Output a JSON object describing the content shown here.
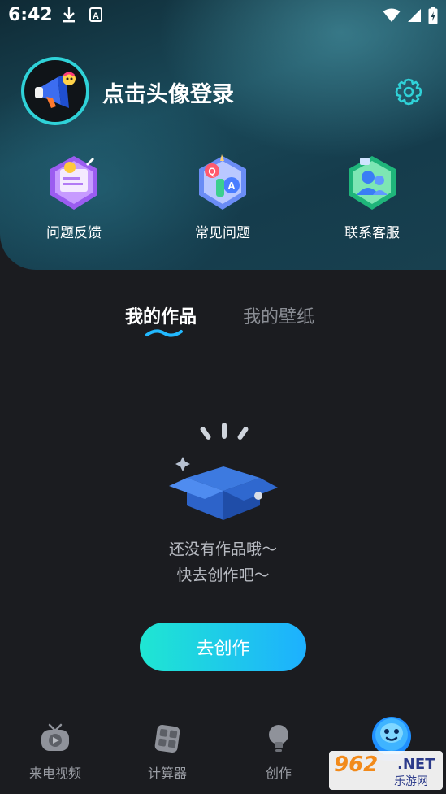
{
  "status_bar": {
    "time": "6:42"
  },
  "profile": {
    "login_text": "点击头像登录"
  },
  "shortcuts": [
    {
      "label": "问题反馈",
      "icon": "feedback-icon"
    },
    {
      "label": "常见问题",
      "icon": "faq-icon"
    },
    {
      "label": "联系客服",
      "icon": "customer-service-icon"
    }
  ],
  "tabs": [
    {
      "label": "我的作品",
      "active": true
    },
    {
      "label": "我的壁纸",
      "active": false
    }
  ],
  "empty_state": {
    "line1": "还没有作品哦～",
    "line2": "快去创作吧～",
    "icon": "empty-box-icon"
  },
  "create_button": {
    "label": "去创作"
  },
  "bottom_nav": [
    {
      "label": "来电视频",
      "icon": "tv-icon"
    },
    {
      "label": "计算器",
      "icon": "calculator-icon"
    },
    {
      "label": "创作",
      "icon": "bulb-icon"
    },
    {
      "label": "",
      "icon": "mascot-icon"
    }
  ],
  "watermark": {
    "number": "962",
    "suffix": ".NET",
    "text": "乐游网"
  },
  "colors": {
    "accent": "#2fd2d8",
    "button_start": "#1fe6d2",
    "button_end": "#1db0ff",
    "background": "#1b1c20"
  }
}
